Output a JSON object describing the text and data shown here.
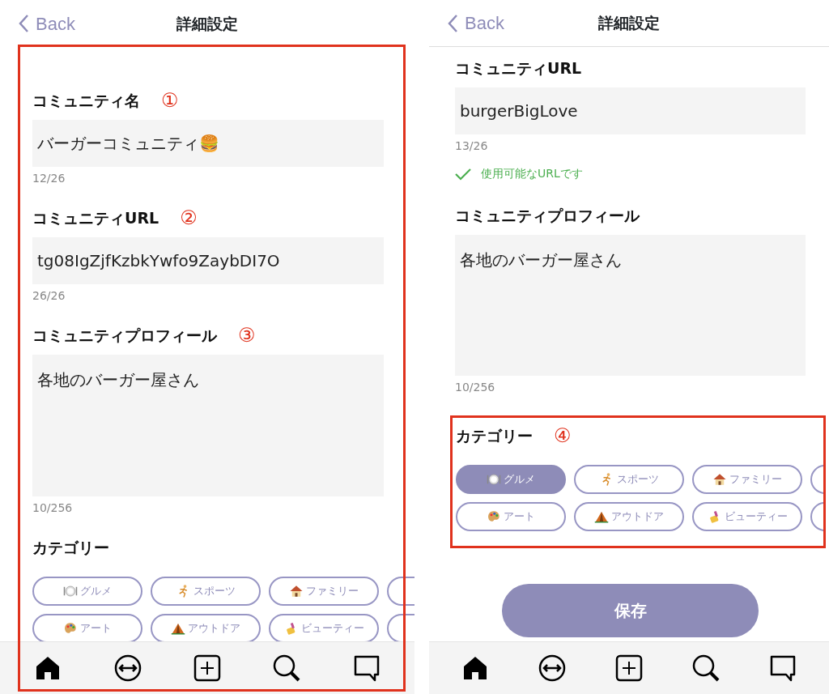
{
  "screens": [
    {
      "back_label": "Back",
      "title": "詳細設定",
      "content_framed": true,
      "sections": [
        {
          "kind": "input",
          "label": "コミュニティ名",
          "marker": "①",
          "value": "バーガーコミュニティ🍔",
          "counter": "12/26"
        },
        {
          "kind": "input",
          "label": "コミュニティURL",
          "marker": "②",
          "value": "tg08IgZjfKzbkYwfo9ZaybDI7O",
          "counter": "26/26"
        },
        {
          "kind": "textarea",
          "label": "コミュニティプロフィール",
          "marker": "③",
          "value": "各地のバーガー屋さん",
          "counter": "10/256"
        },
        {
          "kind": "category",
          "label": "カテゴリー",
          "framed": false,
          "chips": [
            {
              "kind": "gourmet",
              "label": "グルメ",
              "selected": false
            },
            {
              "kind": "sports",
              "label": "スポーツ",
              "selected": false
            },
            {
              "kind": "family",
              "label": "ファミリー",
              "selected": false
            },
            {
              "kind": "partial",
              "selected": false
            },
            {
              "kind": "art",
              "label": "アート",
              "selected": false
            },
            {
              "kind": "outdoor",
              "label": "アウトドア",
              "selected": false
            },
            {
              "kind": "beauty",
              "label": "ビューティー",
              "selected": false
            },
            {
              "kind": "partial",
              "selected": false
            }
          ]
        }
      ],
      "tabs": [
        {
          "kind": "home",
          "selected": true
        },
        {
          "kind": "swap",
          "selected": false
        },
        {
          "kind": "add",
          "selected": false
        },
        {
          "kind": "search",
          "selected": false
        },
        {
          "kind": "chat",
          "selected": false
        }
      ]
    },
    {
      "back_label": "Back",
      "title": "詳細設定",
      "content_framed": false,
      "sections": [
        {
          "kind": "input",
          "label": "コミュニティURL",
          "value": "burgerBigLove",
          "counter": "13/26",
          "validation": "使用可能なURLです"
        },
        {
          "kind": "textarea",
          "label": "コミュニティプロフィール",
          "value": "各地のバーガー屋さん",
          "counter": "10/256"
        },
        {
          "kind": "category",
          "label": "カテゴリー",
          "marker": "④",
          "framed": true,
          "chips": [
            {
              "kind": "gourmet",
              "label": "グルメ",
              "selected": true
            },
            {
              "kind": "sports",
              "label": "スポーツ",
              "selected": false
            },
            {
              "kind": "family",
              "label": "ファミリー",
              "selected": false
            },
            {
              "kind": "partial",
              "selected": false
            },
            {
              "kind": "art",
              "label": "アート",
              "selected": false
            },
            {
              "kind": "outdoor",
              "label": "アウトドア",
              "selected": false
            },
            {
              "kind": "beauty",
              "label": "ビューティー",
              "selected": false
            },
            {
              "kind": "partial",
              "selected": false
            }
          ]
        }
      ],
      "save_button": "保存",
      "tabs": [
        {
          "kind": "home",
          "selected": true
        },
        {
          "kind": "swap",
          "selected": false
        },
        {
          "kind": "add",
          "selected": false
        },
        {
          "kind": "search",
          "selected": false
        },
        {
          "kind": "chat",
          "selected": false
        }
      ]
    }
  ]
}
